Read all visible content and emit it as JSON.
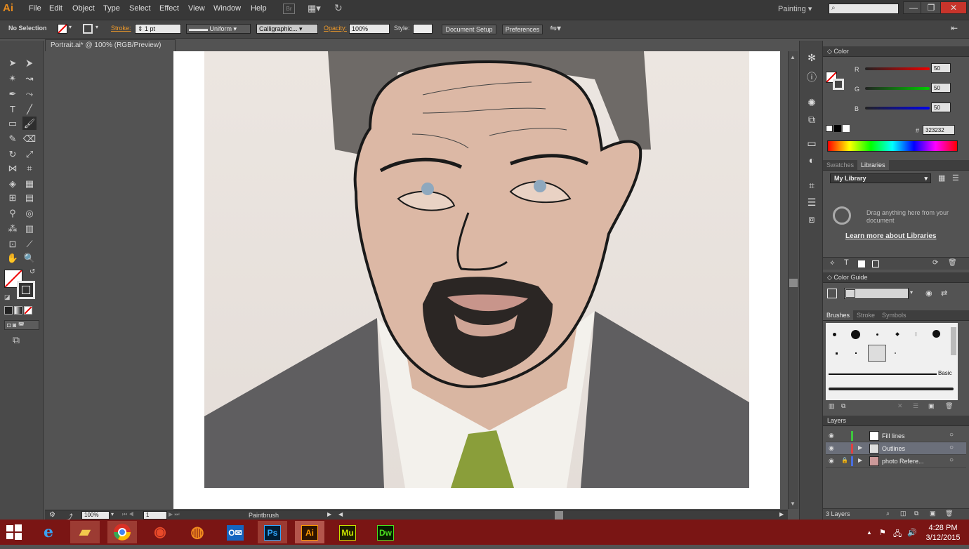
{
  "app": {
    "logo": "Ai",
    "menus": [
      "File",
      "Edit",
      "Object",
      "Type",
      "Select",
      "Effect",
      "View",
      "Window",
      "Help"
    ],
    "workspace": "Painting",
    "window_buttons": [
      "—",
      "❐",
      "✕"
    ],
    "bridge_label": "Br"
  },
  "control": {
    "selection": "No Selection",
    "stroke_label": "Stroke:",
    "stroke_weight": "1 pt",
    "profile": "Uniform",
    "brush": "Calligraphic...",
    "opacity_label": "Opacity:",
    "opacity": "100%",
    "style_label": "Style:",
    "doc_setup": "Document Setup",
    "preferences": "Preferences"
  },
  "document": {
    "tab": "Portrait.ai* @ 100% (RGB/Preview)",
    "zoom": "100%",
    "artboard_num": "1",
    "status_tool": "Paintbrush"
  },
  "color_panel": {
    "title": "Color",
    "r_label": "R",
    "g_label": "G",
    "b_label": "B",
    "r": "50",
    "g": "50",
    "b": "50",
    "hex_label": "#",
    "hex": "323232",
    "fill_color": "#323232"
  },
  "libraries_panel": {
    "tabs": [
      "Swatches",
      "Libraries"
    ],
    "active": "Libraries",
    "library": "My Library",
    "hint": "Drag anything here from your document",
    "learn_more": "Learn more about Libraries"
  },
  "color_guide": {
    "title": "Color Guide"
  },
  "brushes_panel": {
    "tabs": [
      "Brushes",
      "Stroke",
      "Symbols"
    ],
    "active": "Brushes",
    "basic_label": "Basic"
  },
  "layers_panel": {
    "title": "Layers",
    "layers": [
      {
        "name": "Fill lines",
        "color": "#3ec53e"
      },
      {
        "name": "Outlines",
        "color": "#e04040"
      },
      {
        "name": "photo Refere...",
        "color": "#4a6ee0"
      }
    ],
    "count": "3 Layers"
  },
  "taskbar": {
    "apps": [
      "IE",
      "Explorer",
      "Chrome",
      "Media",
      "Firefox",
      "Outlook",
      "Ps",
      "Ai",
      "Mu",
      "Dw"
    ],
    "time": "4:28 PM",
    "date": "3/12/2015"
  }
}
